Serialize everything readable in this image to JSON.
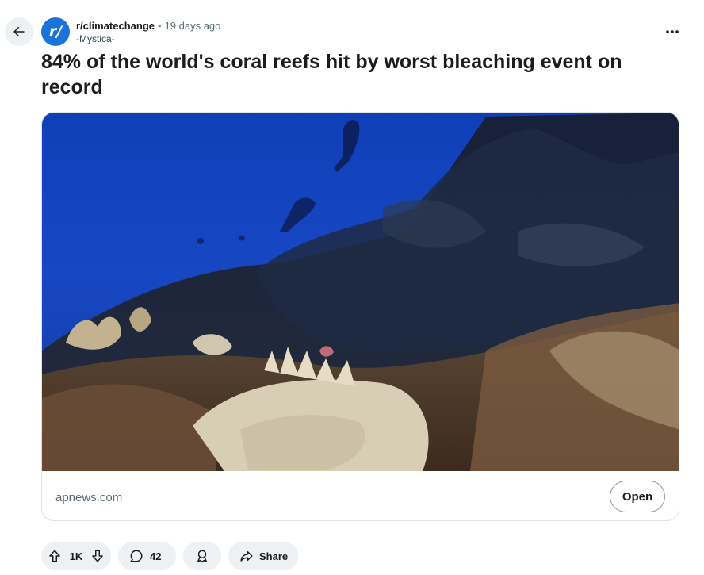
{
  "post": {
    "subreddit": "r/climatechange",
    "separator": "•",
    "age": "19 days ago",
    "author": "-Mystica-",
    "avatar_text": "r/",
    "title": "84% of the world's coral reefs hit by worst bleaching event on record"
  },
  "link": {
    "domain": "apnews.com",
    "open_label": "Open"
  },
  "actions": {
    "votes": "1K",
    "comments": "42",
    "share_label": "Share"
  },
  "icons": {
    "back": "arrow-left-icon",
    "more": "more-horizontal-icon",
    "upvote": "upvote-arrow-icon",
    "downvote": "downvote-arrow-icon",
    "comment": "comment-bubble-icon",
    "award": "award-icon",
    "share": "share-arrow-icon"
  },
  "colors": {
    "avatar": "#1a73d9",
    "pill_background": "#eef1f3",
    "meta_gray": "#5c6c74"
  }
}
